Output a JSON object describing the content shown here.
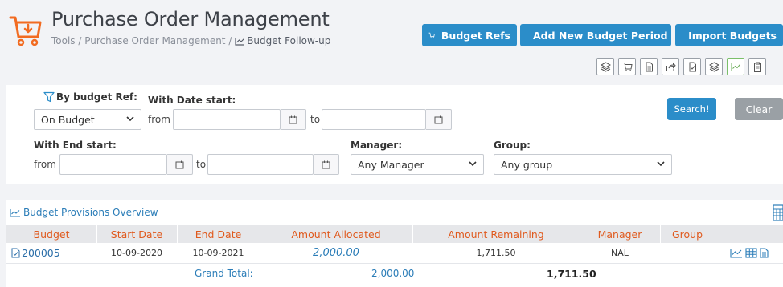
{
  "header": {
    "title": "Purchase Order Management",
    "breadcrumb": {
      "tools": "Tools",
      "sep1": " / ",
      "section": "Purchase Order Management",
      "sep2": " / ",
      "current": "Budget Follow-up"
    },
    "buttons": {
      "budget_refs": "Budget Refs",
      "add_period": "Add New Budget Period",
      "import_budgets": "Import Budgets"
    },
    "toolbar_icons": [
      "layers-icon",
      "cart-icon",
      "document-icon",
      "share-icon",
      "check-document-icon",
      "layers-alt-icon",
      "chart-icon",
      "clipboard-icon"
    ]
  },
  "filters": {
    "by_budget_ref_label": "By budget Ref:",
    "budget_ref_value": "On Budget",
    "date_start_label": "With Date start:",
    "from_label": "from",
    "to_label": "to",
    "date_start_from": "",
    "date_start_to": "",
    "end_start_label": "With End start:",
    "end_start_from": "",
    "end_start_to": "",
    "manager_label": "Manager:",
    "manager_value": "Any Manager",
    "group_label": "Group:",
    "group_value": "Any group",
    "search_label": "Search!",
    "clear_label": "Clear"
  },
  "overview": {
    "title": "Budget Provisions Overview",
    "columns": {
      "budget": "Budget",
      "start_date": "Start Date",
      "end_date": "End Date",
      "amount_allocated": "Amount Allocated",
      "amount_remaining": "Amount Remaining",
      "manager": "Manager",
      "group": "Group"
    },
    "rows": [
      {
        "budget": "200005",
        "start_date": "10-09-2020",
        "end_date": "10-09-2021",
        "amount_allocated": "2,000.00",
        "amount_remaining": "1,711.50",
        "manager": "NAL",
        "group": ""
      }
    ],
    "totals": {
      "label": "Grand Total:",
      "amount_allocated": "2,000.00",
      "amount_remaining": "1,711.50"
    }
  },
  "colors": {
    "primary": "#2b8dc9",
    "header_accent": "#e05a1e",
    "logo": "#f26b21",
    "clear": "#9aa0a5"
  }
}
